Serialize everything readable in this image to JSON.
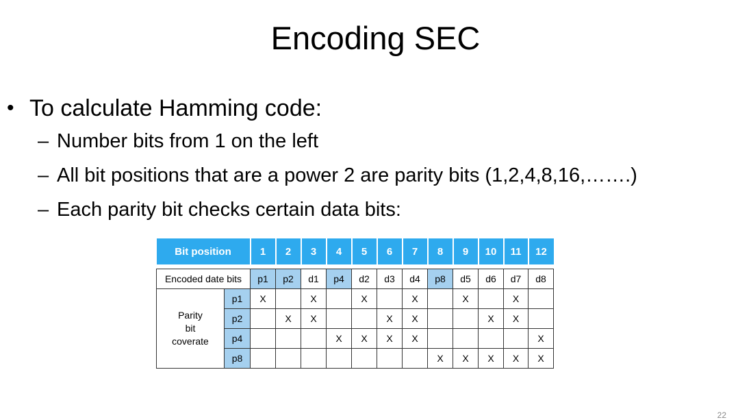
{
  "slide": {
    "title": "Encoding SEC",
    "bullet_main": "To calculate Hamming code:",
    "sub_bullets": [
      "Number bits from 1 on the left",
      "All bit positions that are a power 2 are parity bits (1,2,4,8,16,…….)",
      "Each parity bit checks certain data bits:"
    ],
    "page_number": "22"
  },
  "table": {
    "header_label": "Bit position",
    "positions": [
      "1",
      "2",
      "3",
      "4",
      "5",
      "6",
      "7",
      "8",
      "9",
      "10",
      "11",
      "12"
    ],
    "encoded_label": "Encoded date bits",
    "encoded_bits": [
      "p1",
      "p2",
      "d1",
      "p4",
      "d2",
      "d3",
      "d4",
      "p8",
      "d5",
      "d6",
      "d7",
      "d8"
    ],
    "parity_positions": [
      1,
      2,
      4,
      8
    ],
    "coverage_label": [
      "Parity",
      "bit",
      "coverate"
    ],
    "coverage_rows": [
      {
        "label": "p1",
        "cells": [
          "X",
          "",
          "X",
          "",
          "X",
          "",
          "X",
          "",
          "X",
          "",
          "X",
          ""
        ]
      },
      {
        "label": "p2",
        "cells": [
          "",
          "X",
          "X",
          "",
          "",
          "X",
          "X",
          "",
          "",
          "X",
          "X",
          ""
        ]
      },
      {
        "label": "p4",
        "cells": [
          "",
          "",
          "",
          "X",
          "X",
          "X",
          "X",
          "",
          "",
          "",
          "",
          "X"
        ]
      },
      {
        "label": "p8",
        "cells": [
          "",
          "",
          "",
          "",
          "",
          "",
          "",
          "X",
          "X",
          "X",
          "X",
          "X"
        ]
      }
    ]
  }
}
